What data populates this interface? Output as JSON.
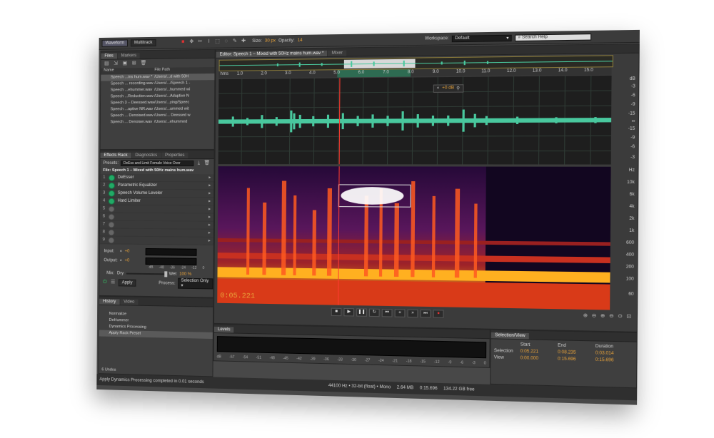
{
  "toolbar": {
    "waveform": "Waveform",
    "multitrack": "Multitrack",
    "size_label": "Size:",
    "size_value": "30 px",
    "opacity_label": "Opacity:",
    "opacity_value": "14",
    "workspace_label": "Workspace:",
    "workspace_value": "Default",
    "search_placeholder": "Search Help"
  },
  "files_panel": {
    "tabs": [
      "Files",
      "Markers"
    ],
    "columns": [
      "Name",
      "File Path"
    ],
    "rows": [
      {
        "name": "Speech ...ins hum.wav *",
        "path": "/Users/...d with 50H"
      },
      {
        "name": "Speech ... recording.wav",
        "path": "/Users/.../Speech 1 -"
      },
      {
        "name": "Speech ...ehummer.wav",
        "path": "/Users/...hummed wi"
      },
      {
        "name": "Speech ...Reduction.wav",
        "path": "/Users/...Adaptive N"
      },
      {
        "name": "Speech 3 – Deessed.wav",
        "path": "/Users/...ying/Speec"
      },
      {
        "name": "Speech ...aptive NR.wav",
        "path": "/Users/...ummed wit"
      },
      {
        "name": "Speech ... Denoised.wav",
        "path": "/Users/... Deessed w"
      },
      {
        "name": "Speech ... Denoiser.wav",
        "path": "/Users/...ehummed"
      }
    ]
  },
  "effects_rack": {
    "tabs": [
      "Effects Rack",
      "Diagnostics",
      "Properties"
    ],
    "presets_label": "Presets:",
    "preset_value": "DeEss and Limit Female Voice Over",
    "file_title": "File: Speech 1 – Mixed with 50Hz mains hum.wav",
    "effects": [
      {
        "num": "1",
        "name": "DeEsser"
      },
      {
        "num": "2",
        "name": "Parametric Equalizer"
      },
      {
        "num": "3",
        "name": "Speech Volume Leveler"
      },
      {
        "num": "4",
        "name": "Hard Limiter"
      },
      {
        "num": "5",
        "name": ""
      },
      {
        "num": "6",
        "name": ""
      },
      {
        "num": "7",
        "name": ""
      },
      {
        "num": "8",
        "name": ""
      },
      {
        "num": "9",
        "name": ""
      }
    ],
    "input_label": "Input:",
    "input_value": "+0",
    "output_label": "Output:",
    "output_value": "+0",
    "meter_scale": [
      "dB",
      "-48",
      "-36",
      "-24",
      "-12",
      "0"
    ],
    "mix_label": "Mix:",
    "dry_label": "Dry",
    "wet_label": "Wet",
    "wet_value": "100 %",
    "apply": "Apply",
    "process_label": "Process:",
    "process_value": "Selection Only"
  },
  "history_panel": {
    "tabs": [
      "History",
      "Video"
    ],
    "items": [
      "Normalize",
      "DeHummer",
      "Dynamics Processing",
      "Apply Rack Preset"
    ],
    "undos": "6 Undos"
  },
  "status_bar": {
    "message": "Apply Dynamics Processing completed in 0.01 seconds",
    "format": "44100 Hz • 32-bit (float) • Mono",
    "file_size": "2.64 MB",
    "duration": "0:15.696",
    "free_space": "134.22 GB free"
  },
  "editor": {
    "tabs": [
      "Editor: Speech 1 – Mixed with 50Hz mains hum.wav *",
      "Mixer"
    ],
    "ruler_unit": "hms",
    "ruler_ticks": [
      "1.0",
      "2.0",
      "3.0",
      "4.0",
      "5.0",
      "6.0",
      "7.0",
      "8.0",
      "9.0",
      "10.0",
      "11.0",
      "12.0",
      "13.0",
      "14.0",
      "15.0"
    ],
    "hud_value": "+0 dB",
    "db_scale": [
      "dB",
      "-3",
      "-6",
      "-9",
      "-15",
      "∞",
      "-15",
      "-9",
      "-6",
      "-3"
    ],
    "hz_scale": [
      "Hz",
      "10k",
      "6k",
      "4k",
      "2k",
      "1k",
      "600",
      "400",
      "200",
      "100",
      "60"
    ],
    "current_time": "0:05.221",
    "transport": [
      "stop",
      "play",
      "pause",
      "loop",
      "go-to-start",
      "rewind",
      "fast-forward",
      "go-to-end",
      "record"
    ],
    "colors": {
      "waveform": "#49c89e",
      "playhead": "#ff3b30",
      "time_text": "#e8a23a"
    }
  },
  "levels": {
    "title": "Levels",
    "scale": [
      "dB",
      "-57",
      "-54",
      "-51",
      "-48",
      "-45",
      "-42",
      "-39",
      "-36",
      "-33",
      "-30",
      "-27",
      "-24",
      "-21",
      "-18",
      "-15",
      "-12",
      "-9",
      "-6",
      "-3",
      "0"
    ]
  },
  "selection_view": {
    "title": "Selection/View",
    "columns": [
      "Start",
      "End",
      "Duration"
    ],
    "selection_label": "Selection",
    "selection": [
      "0:05.221",
      "0:08.235",
      "0:03.014"
    ],
    "view_label": "View",
    "view": [
      "0:00.000",
      "0:15.696",
      "0:15.696"
    ]
  }
}
